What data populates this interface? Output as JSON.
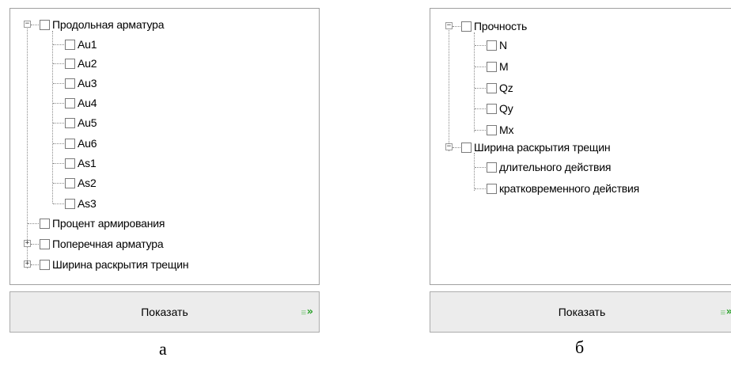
{
  "panel_a": {
    "tree": {
      "root1": {
        "label": "Продольная арматура",
        "expander": "−",
        "children": [
          "Au1",
          "Au2",
          "Au3",
          "Au4",
          "Au5",
          "Au6",
          "As1",
          "As2",
          "As3"
        ]
      },
      "root2": {
        "label": "Процент армирования"
      },
      "root3": {
        "label": "Поперечная арматура",
        "expander": "+"
      },
      "root4": {
        "label": "Ширина раскрытия трещин",
        "expander": "+"
      }
    },
    "button": {
      "label": "Показать",
      "icon": "»"
    },
    "caption": "а"
  },
  "panel_b": {
    "tree": {
      "root1": {
        "label": "Прочность",
        "expander": "−",
        "children": [
          "N",
          "M",
          "Qz",
          "Qy",
          "Mx"
        ]
      },
      "root2": {
        "label": "Ширина раскрытия трещин",
        "expander": "−",
        "children": [
          "длительного действия",
          "кратковременного действия"
        ]
      }
    },
    "button": {
      "label": "Показать",
      "icon": "»"
    },
    "caption": "б"
  }
}
